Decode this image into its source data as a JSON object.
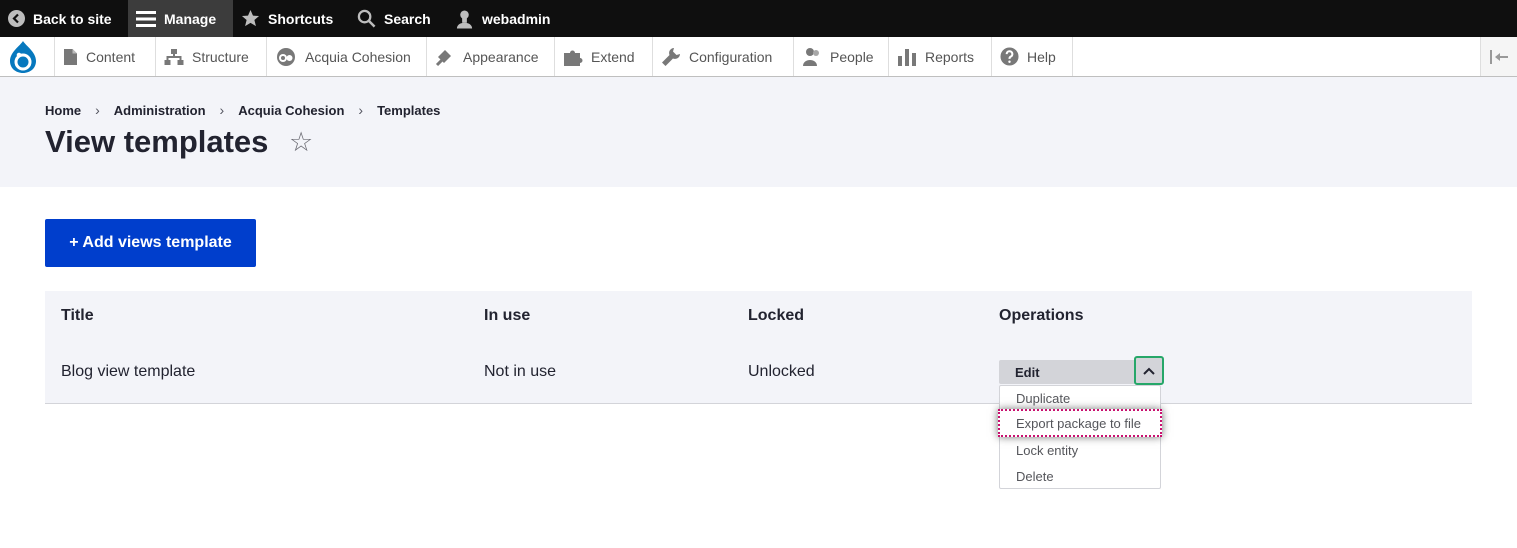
{
  "topbar": {
    "back_label": "Back to site",
    "manage_label": "Manage",
    "shortcuts_label": "Shortcuts",
    "search_label": "Search",
    "user_label": "webadmin"
  },
  "toolbar": {
    "tabs": [
      {
        "label": "Content",
        "icon": "file-icon"
      },
      {
        "label": "Structure",
        "icon": "sitemap-icon"
      },
      {
        "label": "Acquia Cohesion",
        "icon": "cohesion-icon"
      },
      {
        "label": "Appearance",
        "icon": "paintbrush-icon"
      },
      {
        "label": "Extend",
        "icon": "puzzle-icon"
      },
      {
        "label": "Configuration",
        "icon": "wrench-icon"
      },
      {
        "label": "People",
        "icon": "people-icon"
      },
      {
        "label": "Reports",
        "icon": "bar-chart-icon"
      },
      {
        "label": "Help",
        "icon": "help-icon"
      }
    ]
  },
  "breadcrumb": {
    "items": [
      "Home",
      "Administration",
      "Acquia Cohesion",
      "Templates"
    ],
    "separator": "›"
  },
  "page": {
    "title": "View templates",
    "star_glyph": "☆"
  },
  "actions": {
    "add_label": "+ Add views template"
  },
  "table": {
    "headers": [
      "Title",
      "In use",
      "Locked",
      "Operations"
    ],
    "rows": [
      {
        "title": "Blog view template",
        "in_use": "Not in use",
        "locked": "Unlocked"
      }
    ]
  },
  "operations": {
    "primary": "Edit",
    "menu": [
      "Duplicate",
      "Export package to file",
      "Lock entity",
      "Delete"
    ],
    "highlighted": "Export package to file"
  },
  "colors": {
    "topbar_bg": "#0f0f0f",
    "primary_button": "#003ecc",
    "header_bg": "#f3f4f9",
    "focus_ring": "#26a769",
    "highlight_outline": "#c8106f"
  }
}
